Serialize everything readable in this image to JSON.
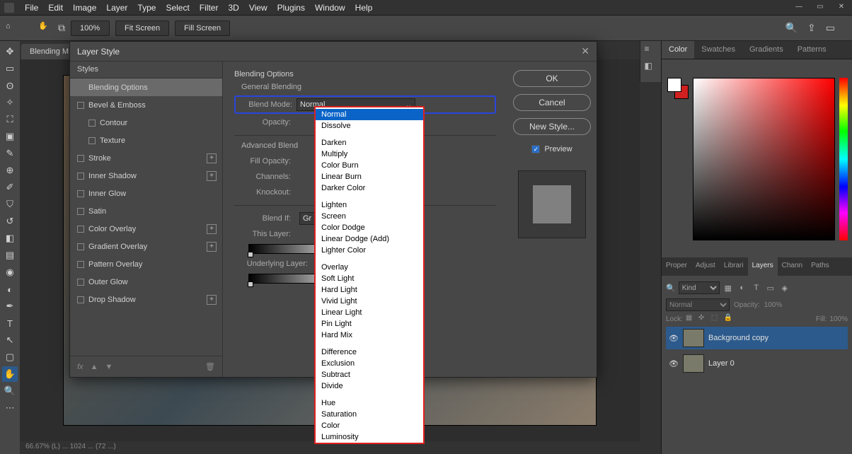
{
  "menubar": [
    "File",
    "Edit",
    "Image",
    "Layer",
    "Type",
    "Select",
    "Filter",
    "3D",
    "View",
    "Plugins",
    "Window",
    "Help"
  ],
  "optionsbar": {
    "zoom": "100%",
    "fit": "Fit Screen",
    "fill": "Fill Screen"
  },
  "doctab": "Blending M",
  "statusbar": "66.67%      (L) ... 1024 ... (72 ...)",
  "dialog": {
    "title": "Layer Style",
    "sidebar_header": "Styles",
    "styles": [
      {
        "label": "Blending Options",
        "selected": true,
        "checkbox": false
      },
      {
        "label": "Bevel & Emboss",
        "checkbox": true
      },
      {
        "label": "Contour",
        "checkbox": true,
        "indent": true
      },
      {
        "label": "Texture",
        "checkbox": true,
        "indent": true
      },
      {
        "label": "Stroke",
        "checkbox": true,
        "plus": true
      },
      {
        "label": "Inner Shadow",
        "checkbox": true,
        "plus": true
      },
      {
        "label": "Inner Glow",
        "checkbox": true
      },
      {
        "label": "Satin",
        "checkbox": true
      },
      {
        "label": "Color Overlay",
        "checkbox": true,
        "plus": true
      },
      {
        "label": "Gradient Overlay",
        "checkbox": true,
        "plus": true
      },
      {
        "label": "Pattern Overlay",
        "checkbox": true
      },
      {
        "label": "Outer Glow",
        "checkbox": true
      },
      {
        "label": "Drop Shadow",
        "checkbox": true,
        "plus": true
      }
    ],
    "fx_label": "fx",
    "main": {
      "section": "Blending Options",
      "general": "General Blending",
      "blend_mode_label": "Blend Mode:",
      "blend_mode_value": "Normal",
      "opacity_label": "Opacity:",
      "advanced": "Advanced Blend",
      "fill_opacity_label": "Fill Opacity:",
      "channels_label": "Channels:",
      "knockout_label": "Knockout:",
      "blend_if_label": "Blend If:",
      "blend_if_value": "Gr",
      "this_layer_label": "This Layer:",
      "underlying_label": "Underlying Layer:"
    },
    "buttons": {
      "ok": "OK",
      "cancel": "Cancel",
      "newstyle": "New Style...",
      "preview": "Preview"
    }
  },
  "blend_modes": {
    "selected": "Normal",
    "groups": [
      [
        "Normal",
        "Dissolve"
      ],
      [
        "Darken",
        "Multiply",
        "Color Burn",
        "Linear Burn",
        "Darker Color"
      ],
      [
        "Lighten",
        "Screen",
        "Color Dodge",
        "Linear Dodge (Add)",
        "Lighter Color"
      ],
      [
        "Overlay",
        "Soft Light",
        "Hard Light",
        "Vivid Light",
        "Linear Light",
        "Pin Light",
        "Hard Mix"
      ],
      [
        "Difference",
        "Exclusion",
        "Subtract",
        "Divide"
      ],
      [
        "Hue",
        "Saturation",
        "Color",
        "Luminosity"
      ]
    ]
  },
  "right": {
    "color_tabs": [
      "Color",
      "Swatches",
      "Gradients",
      "Patterns"
    ],
    "mid_tabs": [
      "Proper",
      "Adjust",
      "Librari",
      "Layers",
      "Chann",
      "Paths"
    ],
    "layers": {
      "kind": "Kind",
      "blend": "Normal",
      "opacity_label": "Opacity:",
      "opacity": "100%",
      "lock_label": "Lock:",
      "fill_label": "Fill:",
      "fill": "100%",
      "items": [
        {
          "name": "Background copy"
        },
        {
          "name": "Layer 0"
        }
      ]
    }
  }
}
